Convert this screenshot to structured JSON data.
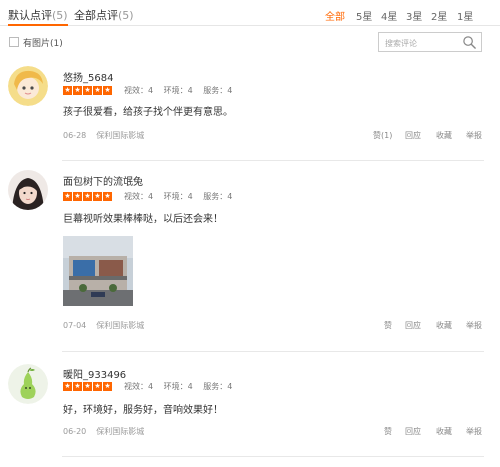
{
  "tabs": {
    "default_label": "默认点评",
    "default_count": "(5)",
    "all_label": "全部点评",
    "all_count": "(5)"
  },
  "star_filters": [
    "全部",
    "5星",
    "4星",
    "3星",
    "2星",
    "1星"
  ],
  "filter": {
    "has_image_label": "有图片(1)",
    "search_placeholder": "搜索评论"
  },
  "reviews": [
    {
      "username": "悠扬_5684",
      "rating_stars": 5,
      "view": "视效：4",
      "env": "环境：4",
      "service": "服务：4",
      "text": "孩子很爱看，给孩子找个伴更有意思。",
      "date": "06-28",
      "cinema": "保利国际影城",
      "like": "赞(1)",
      "reply": "回应",
      "fav": "收藏",
      "report": "举报"
    },
    {
      "username": "面包树下的流氓兔",
      "rating_stars": 5,
      "view": "视效：4",
      "env": "环境：4",
      "service": "服务：4",
      "text": "巨幕视听效果棒棒哒，以后还会来！",
      "date": "07-04",
      "cinema": "保利国际影城",
      "like": "赞",
      "reply": "回应",
      "fav": "收藏",
      "report": "举报"
    },
    {
      "username": "暖阳_933496",
      "rating_stars": 5,
      "view": "视效：4",
      "env": "环境：4",
      "service": "服务：4",
      "text": "好，环境好，服务好，音响效果好！",
      "date": "06-20",
      "cinema": "保利国际影城",
      "like": "赞",
      "reply": "回应",
      "fav": "收藏",
      "report": "举报"
    }
  ],
  "colors": {
    "accent": "#ff6600",
    "divider": "#e8e8e8"
  }
}
